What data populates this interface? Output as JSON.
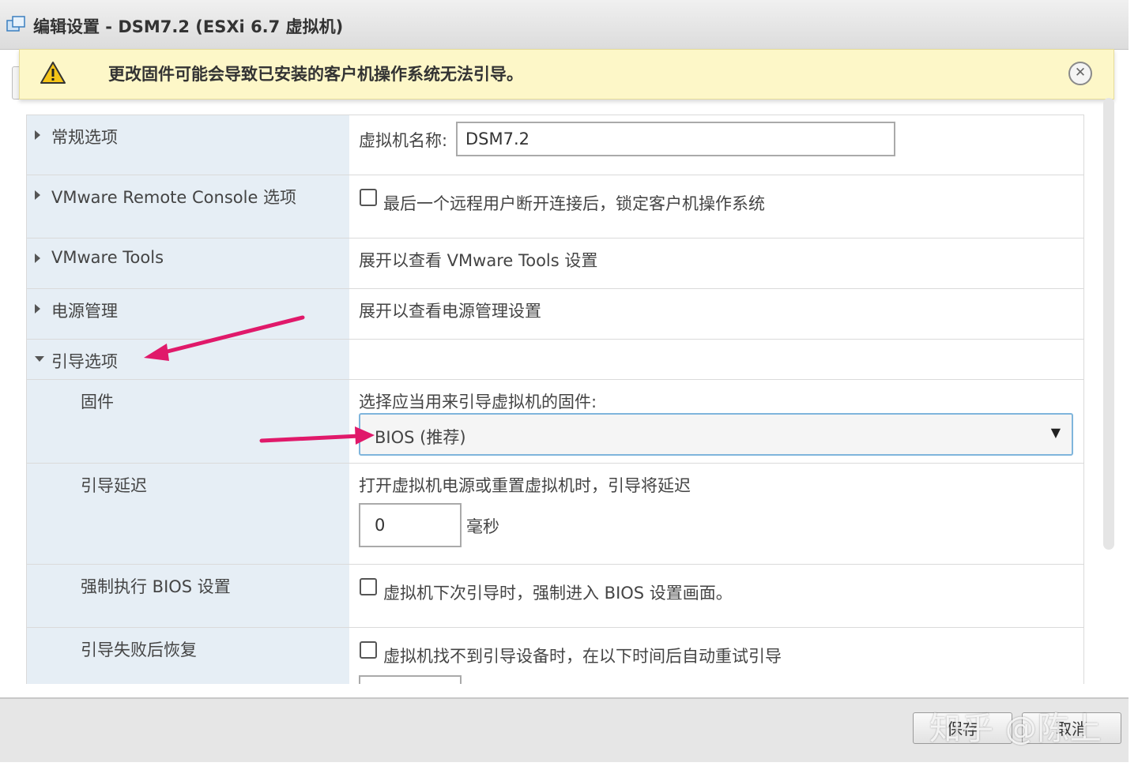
{
  "window": {
    "title": "编辑设置 - DSM7.2 (ESXi 6.7 虚拟机)",
    "title_icon": "vm-icon"
  },
  "warning": {
    "icon": "warning-triangle-icon",
    "text": "更改固件可能会导致已安装的客户机操作系统无法引导。",
    "close_icon": "close-icon",
    "close_glyph": "✕"
  },
  "sections": [
    {
      "label": "常规选项",
      "expanded": false,
      "field_label": "虚拟机名称:",
      "field_value": "DSM7.2"
    },
    {
      "label": "VMware Remote Console 选项",
      "expanded": false,
      "checkbox_checked": false,
      "checkbox_label": "最后一个远程用户断开连接后，锁定客户机操作系统"
    },
    {
      "label": "VMware Tools",
      "expanded": false,
      "summary": "展开以查看 VMware Tools 设置"
    },
    {
      "label": "电源管理",
      "expanded": false,
      "summary": "展开以查看电源管理设置"
    },
    {
      "label": "引导选项",
      "expanded": true
    }
  ],
  "boot_options": {
    "firmware": {
      "label": "固件",
      "description": "选择应当用来引导虚拟机的固件:",
      "selected": "BIOS (推荐)",
      "dropdown_glyph": "▼"
    },
    "boot_delay": {
      "label": "引导延迟",
      "description": "打开虚拟机电源或重置虚拟机时，引导将延迟",
      "value": "0",
      "unit": "毫秒"
    },
    "force_bios": {
      "label": "强制执行 BIOS 设置",
      "checkbox_checked": false,
      "checkbox_label": "虚拟机下次引导时，强制进入 BIOS 设置画面。"
    },
    "failed_boot_recovery": {
      "label": "引导失败后恢复",
      "checkbox_checked": false,
      "checkbox_label": "虚拟机找不到引导设备时，在以下时间后自动重试引导"
    }
  },
  "footer": {
    "save_label": "保存",
    "cancel_label": "取消"
  },
  "watermark": "知乎 @陈上",
  "colors": {
    "annotation_arrow": "#e0196a",
    "left_column_bg": "#e6eef5",
    "warning_bg": "#fdf7c8",
    "select_border": "#7fb5dc"
  }
}
